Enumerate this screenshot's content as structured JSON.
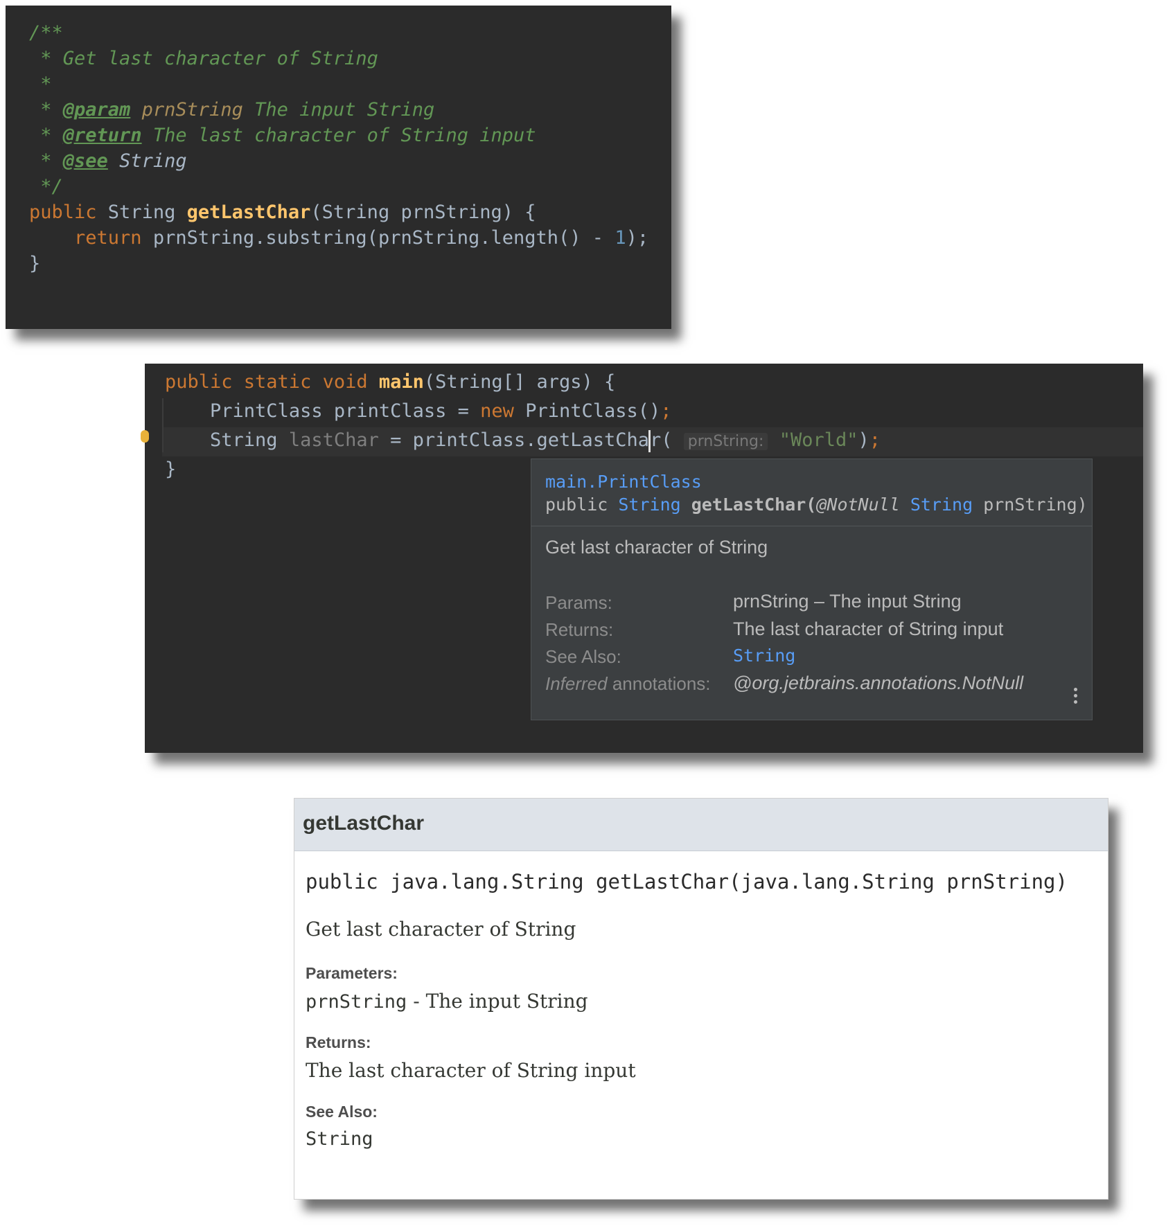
{
  "source_panel": {
    "doc_open": "/**",
    "doc_summary": " * Get last character of String",
    "doc_blank": " *",
    "param_prefix": " * ",
    "param_tag": "@param",
    "param_name": "prnString",
    "param_desc": " The input String",
    "return_prefix": " * ",
    "return_tag": "@return",
    "return_desc": " The last character of String input",
    "see_prefix": " * ",
    "see_tag": "@see",
    "see_value": " String",
    "doc_close": " */",
    "sig_kw": "public",
    "sig_type": " String ",
    "sig_name": "getLastChar",
    "sig_params": "(String prnString) {",
    "body_indent": "    ",
    "body_kw": "return",
    "body_expr": " prnString.substring(prnString.length() - ",
    "body_num": "1",
    "body_close": ");",
    "close_brace": "}"
  },
  "editor_panel": {
    "main_kw": "public static void ",
    "main_name": "main",
    "main_params": "(String[] args) {",
    "l2_indent": "    ",
    "l2_a": "PrintClass printClass = ",
    "l2_new": "new",
    "l2_b": " PrintClass()",
    "l2_semi": ";",
    "l3_indent": "    ",
    "l3_type": "String ",
    "l3_var": "lastChar",
    "l3_a": " = printClass.",
    "l3_call1": "getLastCha",
    "l3_call2": "r",
    "l3_paren": "( ",
    "l3_hint": "prnString:",
    "l3_str": "\"World\"",
    "l3_close": ")",
    "l3_semi": ";",
    "close_brace": "}",
    "popup": {
      "class_name": "main.PrintClass",
      "sig_mod": "public ",
      "sig_type": "String",
      "sig_name": " getLastChar(",
      "sig_ann": "@NotNull",
      "sig_ptype": "String",
      "sig_tail": " prnString)",
      "description": "Get last character of String",
      "params_label": "Params:",
      "params_value": "prnString – The input String",
      "returns_label": "Returns:",
      "returns_value": "The last character of String input",
      "see_label": "See Also:",
      "see_value": "String",
      "inferred_italic": "Inferred",
      "inferred_label": " annotations:",
      "inferred_value": "@org.jetbrains.annotations.NotNull"
    }
  },
  "html_doc_panel": {
    "title": "getLastChar",
    "signature": "public java.lang.String getLastChar(java.lang.String prnString)",
    "description": "Get last character of String",
    "params_label": "Parameters:",
    "param_name": "prnString",
    "param_desc": " - The input String",
    "returns_label": "Returns:",
    "returns_value": "The last character of String input",
    "see_label": "See Also:",
    "see_value": "String"
  }
}
